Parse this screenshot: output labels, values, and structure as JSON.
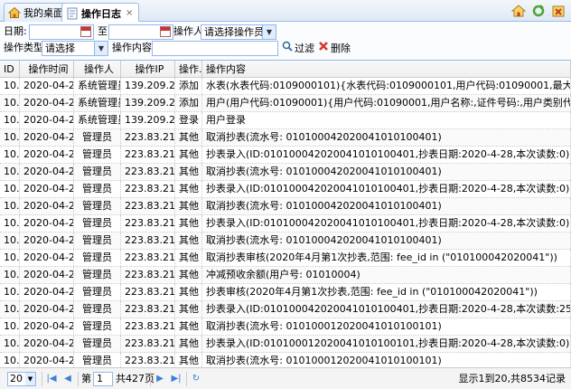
{
  "tabs": [
    {
      "label": "我的桌面",
      "icon": "home-icon"
    },
    {
      "label": "操作日志",
      "icon": "document-icon",
      "active": true
    }
  ],
  "toolbar_icons": [
    "home-icon",
    "refresh-icon",
    "close-all-icon"
  ],
  "filters": {
    "date_label": "日期:",
    "date_to_label": "至",
    "operator_label": "操作人:",
    "operator_value": "请选择操作员",
    "op_type_label": "操作类型:",
    "op_type_value": "请选择",
    "content_label": "操作内容:",
    "search_label": "过滤",
    "delete_label": "删除"
  },
  "table": {
    "headers": [
      "ID",
      "操作时间",
      "操作人",
      "操作IP",
      "操作...",
      "操作内容"
    ],
    "rows": [
      [
        "10...",
        "2020-04-2...",
        "系统管理员",
        "139.209.2...",
        "添加",
        "水表(水表代码:0109000101){水表代码:0109000101,用户代码:01090001,最大量程:0,最低用水..."
      ],
      [
        "10...",
        "2020-04-2...",
        "系统管理员",
        "139.209.2...",
        "添加",
        "用户(用户代码:01090001){用户代码:01090001,用户名称:,证件号码:,用户类别代码:03,片区代码:..."
      ],
      [
        "10...",
        "2020-04-2...",
        "系统管理员",
        "139.209.2...",
        "登录",
        "用户登录"
      ],
      [
        "10...",
        "2020-04-2...",
        "管理员",
        "223.83.21...",
        "其他",
        "取消抄表(流水号: 010100042020041010100401)"
      ],
      [
        "10...",
        "2020-04-2...",
        "管理员",
        "223.83.21...",
        "其他",
        "抄表录入(ID:010100042020041010100401,抄表日期:2020-4-28,本次读数:0)"
      ],
      [
        "10...",
        "2020-04-2...",
        "管理员",
        "223.83.21...",
        "其他",
        "取消抄表(流水号: 010100042020041010100401)"
      ],
      [
        "10...",
        "2020-04-2...",
        "管理员",
        "223.83.21...",
        "其他",
        "抄表录入(ID:010100042020041010100401,抄表日期:2020-4-28,本次读数:0)"
      ],
      [
        "10...",
        "2020-04-2...",
        "管理员",
        "223.83.21...",
        "其他",
        "取消抄表(流水号: 010100042020041010100401)"
      ],
      [
        "10...",
        "2020-04-2...",
        "管理员",
        "223.83.21...",
        "其他",
        "抄表录入(ID:010100042020041010100401,抄表日期:2020-4-28,本次读数:0)"
      ],
      [
        "10...",
        "2020-04-2...",
        "管理员",
        "223.83.21...",
        "其他",
        "取消抄表(流水号: 010100042020041010100401)"
      ],
      [
        "10...",
        "2020-04-2...",
        "管理员",
        "223.83.21...",
        "其他",
        "取消抄表审核(2020年4月第1次抄表,范围:  fee_id in (\"010100042020041\"))"
      ],
      [
        "10...",
        "2020-04-2...",
        "管理员",
        "223.83.21...",
        "其他",
        "冲减预收余额(用户号: 01010004)"
      ],
      [
        "10...",
        "2020-04-2...",
        "管理员",
        "223.83.21...",
        "其他",
        "抄表审核(2020年4月第1次抄表,范围:  fee_id in (\"010100042020041\"))"
      ],
      [
        "10...",
        "2020-04-2...",
        "管理员",
        "223.83.21...",
        "其他",
        "抄表录入(ID:010100042020041010100401,抄表日期:2020-4-28,本次读数:25)"
      ],
      [
        "10...",
        "2020-04-2...",
        "管理员",
        "223.83.21...",
        "其他",
        "取消抄表(流水号: 010100012020041010100101)"
      ],
      [
        "10...",
        "2020-04-2...",
        "管理员",
        "223.83.21...",
        "其他",
        "抄表录入(ID:010100012020041010100101,抄表日期:2020-4-28,本次读数:0)"
      ],
      [
        "10...",
        "2020-04-2...",
        "管理员",
        "223.83.21...",
        "其他",
        "取消抄表(流水号: 010100012020041010100101)"
      ],
      [
        "10...",
        "2020-04-2...",
        "管理员",
        "223.83.21...",
        "其他",
        "取消抄表审核(2020年4月第1次抄表,范围:  fee_id in (\"010100012020041\"))"
      ],
      [
        "10...",
        "2020-04-2...",
        "管理员",
        "223.83.21...",
        "其他",
        "冲减预收余额(用户号: 01010001)"
      ]
    ]
  },
  "pager": {
    "page_size": "20",
    "page_label": "第",
    "page_value": "1",
    "total_pages": "共427页",
    "info": "显示1到20,共8534记录"
  },
  "colors": {
    "accent": "#95b8e7",
    "header_bg": "#efefef",
    "tab_border": "#99bbe8"
  }
}
